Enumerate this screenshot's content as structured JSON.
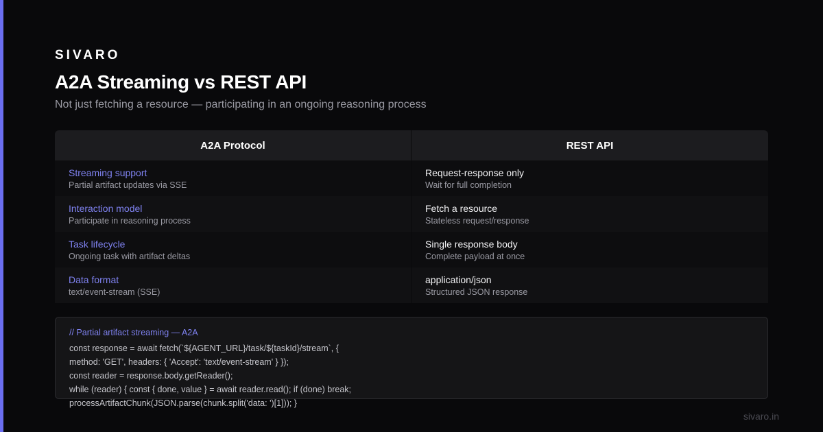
{
  "brand": "SIVARO",
  "title": "A2A Streaming vs REST API",
  "subtitle": "Not just fetching a resource — participating in an ongoing reasoning process",
  "table": {
    "headers": [
      "A2A Protocol",
      "REST API"
    ],
    "rows": [
      {
        "left": {
          "title": "Streaming support",
          "desc": "Partial artifact updates via SSE"
        },
        "right": {
          "title": "Request-response only",
          "desc": "Wait for full completion"
        }
      },
      {
        "left": {
          "title": "Interaction model",
          "desc": "Participate in reasoning process"
        },
        "right": {
          "title": "Fetch a resource",
          "desc": "Stateless request/response"
        }
      },
      {
        "left": {
          "title": "Task lifecycle",
          "desc": "Ongoing task with artifact deltas"
        },
        "right": {
          "title": "Single response body",
          "desc": "Complete payload at once"
        }
      },
      {
        "left": {
          "title": "Data format",
          "desc": "text/event-stream (SSE)"
        },
        "right": {
          "title": "application/json",
          "desc": "Structured JSON response"
        }
      }
    ]
  },
  "code": {
    "comment": "// Partial artifact streaming — A2A",
    "lines": [
      "const response = await fetch(`${AGENT_URL}/task/${taskId}/stream`, {",
      "method: 'GET', headers: { 'Accept': 'text/event-stream' } });",
      "const reader = response.body.getReader();",
      "while (reader) { const { done, value } = await reader.read(); if (done) break;",
      "processArtifactChunk(JSON.parse(chunk.split('data: ')[1])); }"
    ]
  },
  "footer": {
    "domain": "sivaro.in"
  },
  "colors": {
    "accent": "#6b6ef0",
    "background": "#09090b",
    "highlight_text": "#7f82f0"
  }
}
